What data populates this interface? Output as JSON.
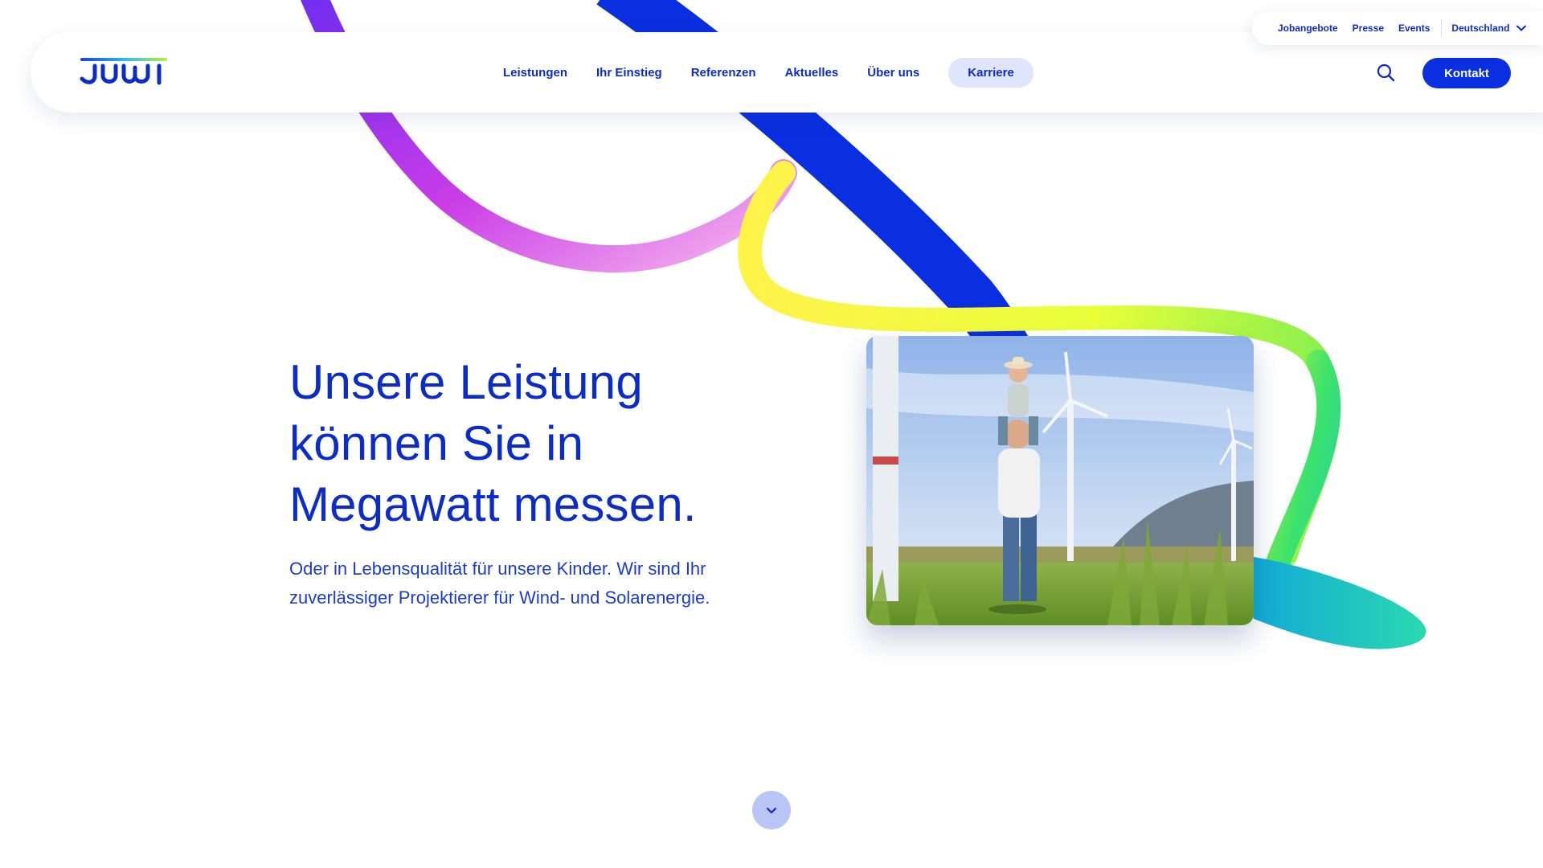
{
  "brand": {
    "logo_alt": "juwi",
    "primary_color": "#0b2cc8",
    "button_color": "#0a2fe0",
    "pill_color": "#dfe5fb"
  },
  "utility": {
    "links": [
      "Jobangebote",
      "Presse",
      "Events"
    ],
    "country": "Deutschland",
    "country_icon": "chevron-down-icon"
  },
  "nav": {
    "items": [
      "Leistungen",
      "Ihr Einstieg",
      "Referenzen",
      "Aktuelles",
      "Über uns"
    ],
    "highlight": "Karriere",
    "search_icon": "search-icon",
    "contact_label": "Kontakt"
  },
  "hero": {
    "title_lines": [
      "Unsere Leistung",
      "können Sie in",
      "Megawatt messen."
    ],
    "subtitle_lines": [
      "Oder in Lebensqualität für unsere Kinder. Wir sind Ihr",
      "zuverlässiger Projektierer für Wind- und Solarenergie."
    ]
  },
  "scroll": {
    "icon": "chevron-down-icon"
  }
}
